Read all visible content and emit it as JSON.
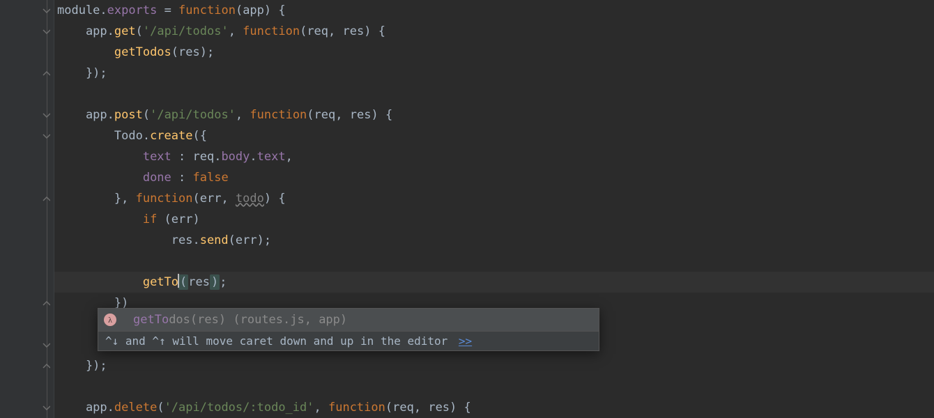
{
  "code": {
    "l1": {
      "t1": "module",
      "t2": ".",
      "t3": "exports",
      "t4": " = ",
      "t5": "function",
      "t6": "(",
      "t7": "app",
      "t8": ") {"
    },
    "l2": {
      "t1": "    app.",
      "t2": "get",
      "t3": "(",
      "t4": "'/api/todos'",
      "t5": ", ",
      "t6": "function",
      "t7": "(",
      "t8": "req",
      "t9": ", ",
      "t10": "res",
      "t11": ") {"
    },
    "l3": {
      "t1": "        ",
      "t2": "getTodos",
      "t3": "(res);"
    },
    "l4": {
      "t1": "    });"
    },
    "l5": {
      "t1": ""
    },
    "l6": {
      "t1": "    app.",
      "t2": "post",
      "t3": "(",
      "t4": "'/api/todos'",
      "t5": ", ",
      "t6": "function",
      "t7": "(",
      "t8": "req",
      "t9": ", ",
      "t10": "res",
      "t11": ") {"
    },
    "l7": {
      "t1": "        Todo.",
      "t2": "create",
      "t3": "({"
    },
    "l8": {
      "t1": "            ",
      "t2": "text",
      "t3": " : req.",
      "t4": "body",
      "t5": ".",
      "t6": "text",
      "t7": ","
    },
    "l9": {
      "t1": "            ",
      "t2": "done",
      "t3": " : ",
      "t4": "false"
    },
    "l10": {
      "t1": "        }, ",
      "t2": "function",
      "t3": "(",
      "t4": "err",
      "t5": ", ",
      "t6": "todo",
      "t7": ") {"
    },
    "l11": {
      "t1": "            ",
      "t2": "if",
      "t3": " (err)"
    },
    "l12": {
      "t1": "                res.",
      "t2": "send",
      "t3": "(err);"
    },
    "l13": {
      "t1": ""
    },
    "l14": {
      "t1": "            ",
      "t2": "getTo",
      "t3": "(",
      "t4": "res",
      "t5": ")",
      "t6": ";"
    },
    "l15": {
      "t1": "        })"
    },
    "l16": {
      "t1": "    });"
    },
    "l17": {
      "t1": ""
    },
    "l18": {
      "t1": "    app.",
      "t2": "delete",
      "t3": "(",
      "t4": "'/api/todos/:todo_id'",
      "t5": ", ",
      "t6": "function",
      "t7": "(",
      "t8": "req",
      "t9": ", ",
      "t10": "res",
      "t11": ") {"
    }
  },
  "completion": {
    "icon": "λ",
    "match": "getTo",
    "rest": "dos",
    "sig_open": "(",
    "sig_args": "res",
    "sig_close": ")",
    "loc_open": " (",
    "loc": "routes.js, app",
    "loc_close": ")"
  },
  "hint": {
    "text": "^↓ and ^↑ will move caret down and up in the editor ",
    "link": ">>"
  }
}
